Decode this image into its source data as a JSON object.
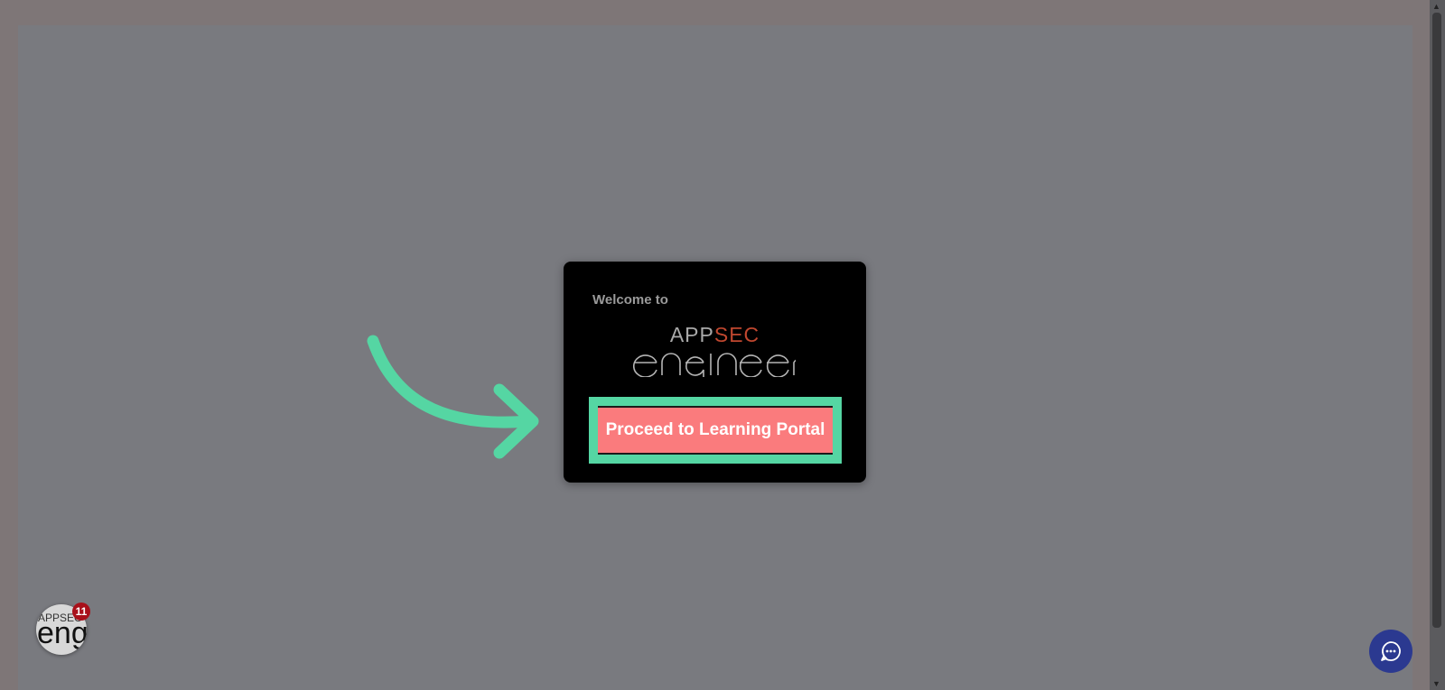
{
  "modal": {
    "welcome": "Welcome to",
    "logo_app": "APP",
    "logo_sec": "SEC",
    "logo_word": "engineer",
    "cta_label": "Proceed to Learning Portal"
  },
  "avatar": {
    "logo_top": "APPSEC",
    "logo_word": "engi",
    "badge_count": "11"
  },
  "colors": {
    "highlight": "#55d6a3",
    "cta_bg": "#fa7b7d",
    "logo_sec": "#c0472f",
    "chat_bg": "#2b3990",
    "badge_bg": "#a8101a"
  },
  "icons": {
    "pointer": "curved-arrow-icon",
    "chat": "chat-bubble-icon"
  }
}
